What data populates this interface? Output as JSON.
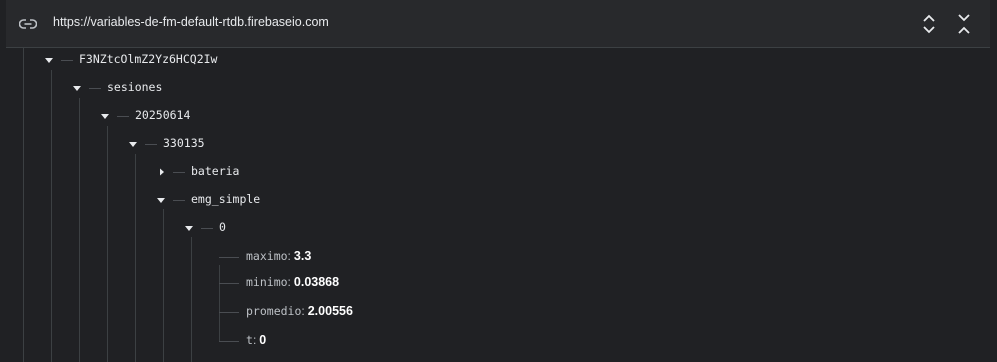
{
  "url": "https://variables-de-fm-default-rtdb.firebaseio.com",
  "icons": {
    "link": "link-icon",
    "expand": "chevrons-expand-icon",
    "collapse": "chevrons-collapse-icon",
    "caret_open": "caret-down-icon",
    "caret_closed": "caret-right-icon"
  },
  "tree": {
    "root_key": "F3NZtcOlmZ2Yz6HCQ2Iw",
    "sesiones": "sesiones",
    "date": "20250614",
    "session": "330135",
    "bateria": "bateria",
    "emg_simple": "emg_simple",
    "index": "0",
    "leaves": [
      {
        "key": "maximo",
        "value": "3.3"
      },
      {
        "key": "minimo",
        "value": "0.03868"
      },
      {
        "key": "promedio",
        "value": "2.00556"
      },
      {
        "key": "t",
        "value": "0"
      }
    ]
  }
}
